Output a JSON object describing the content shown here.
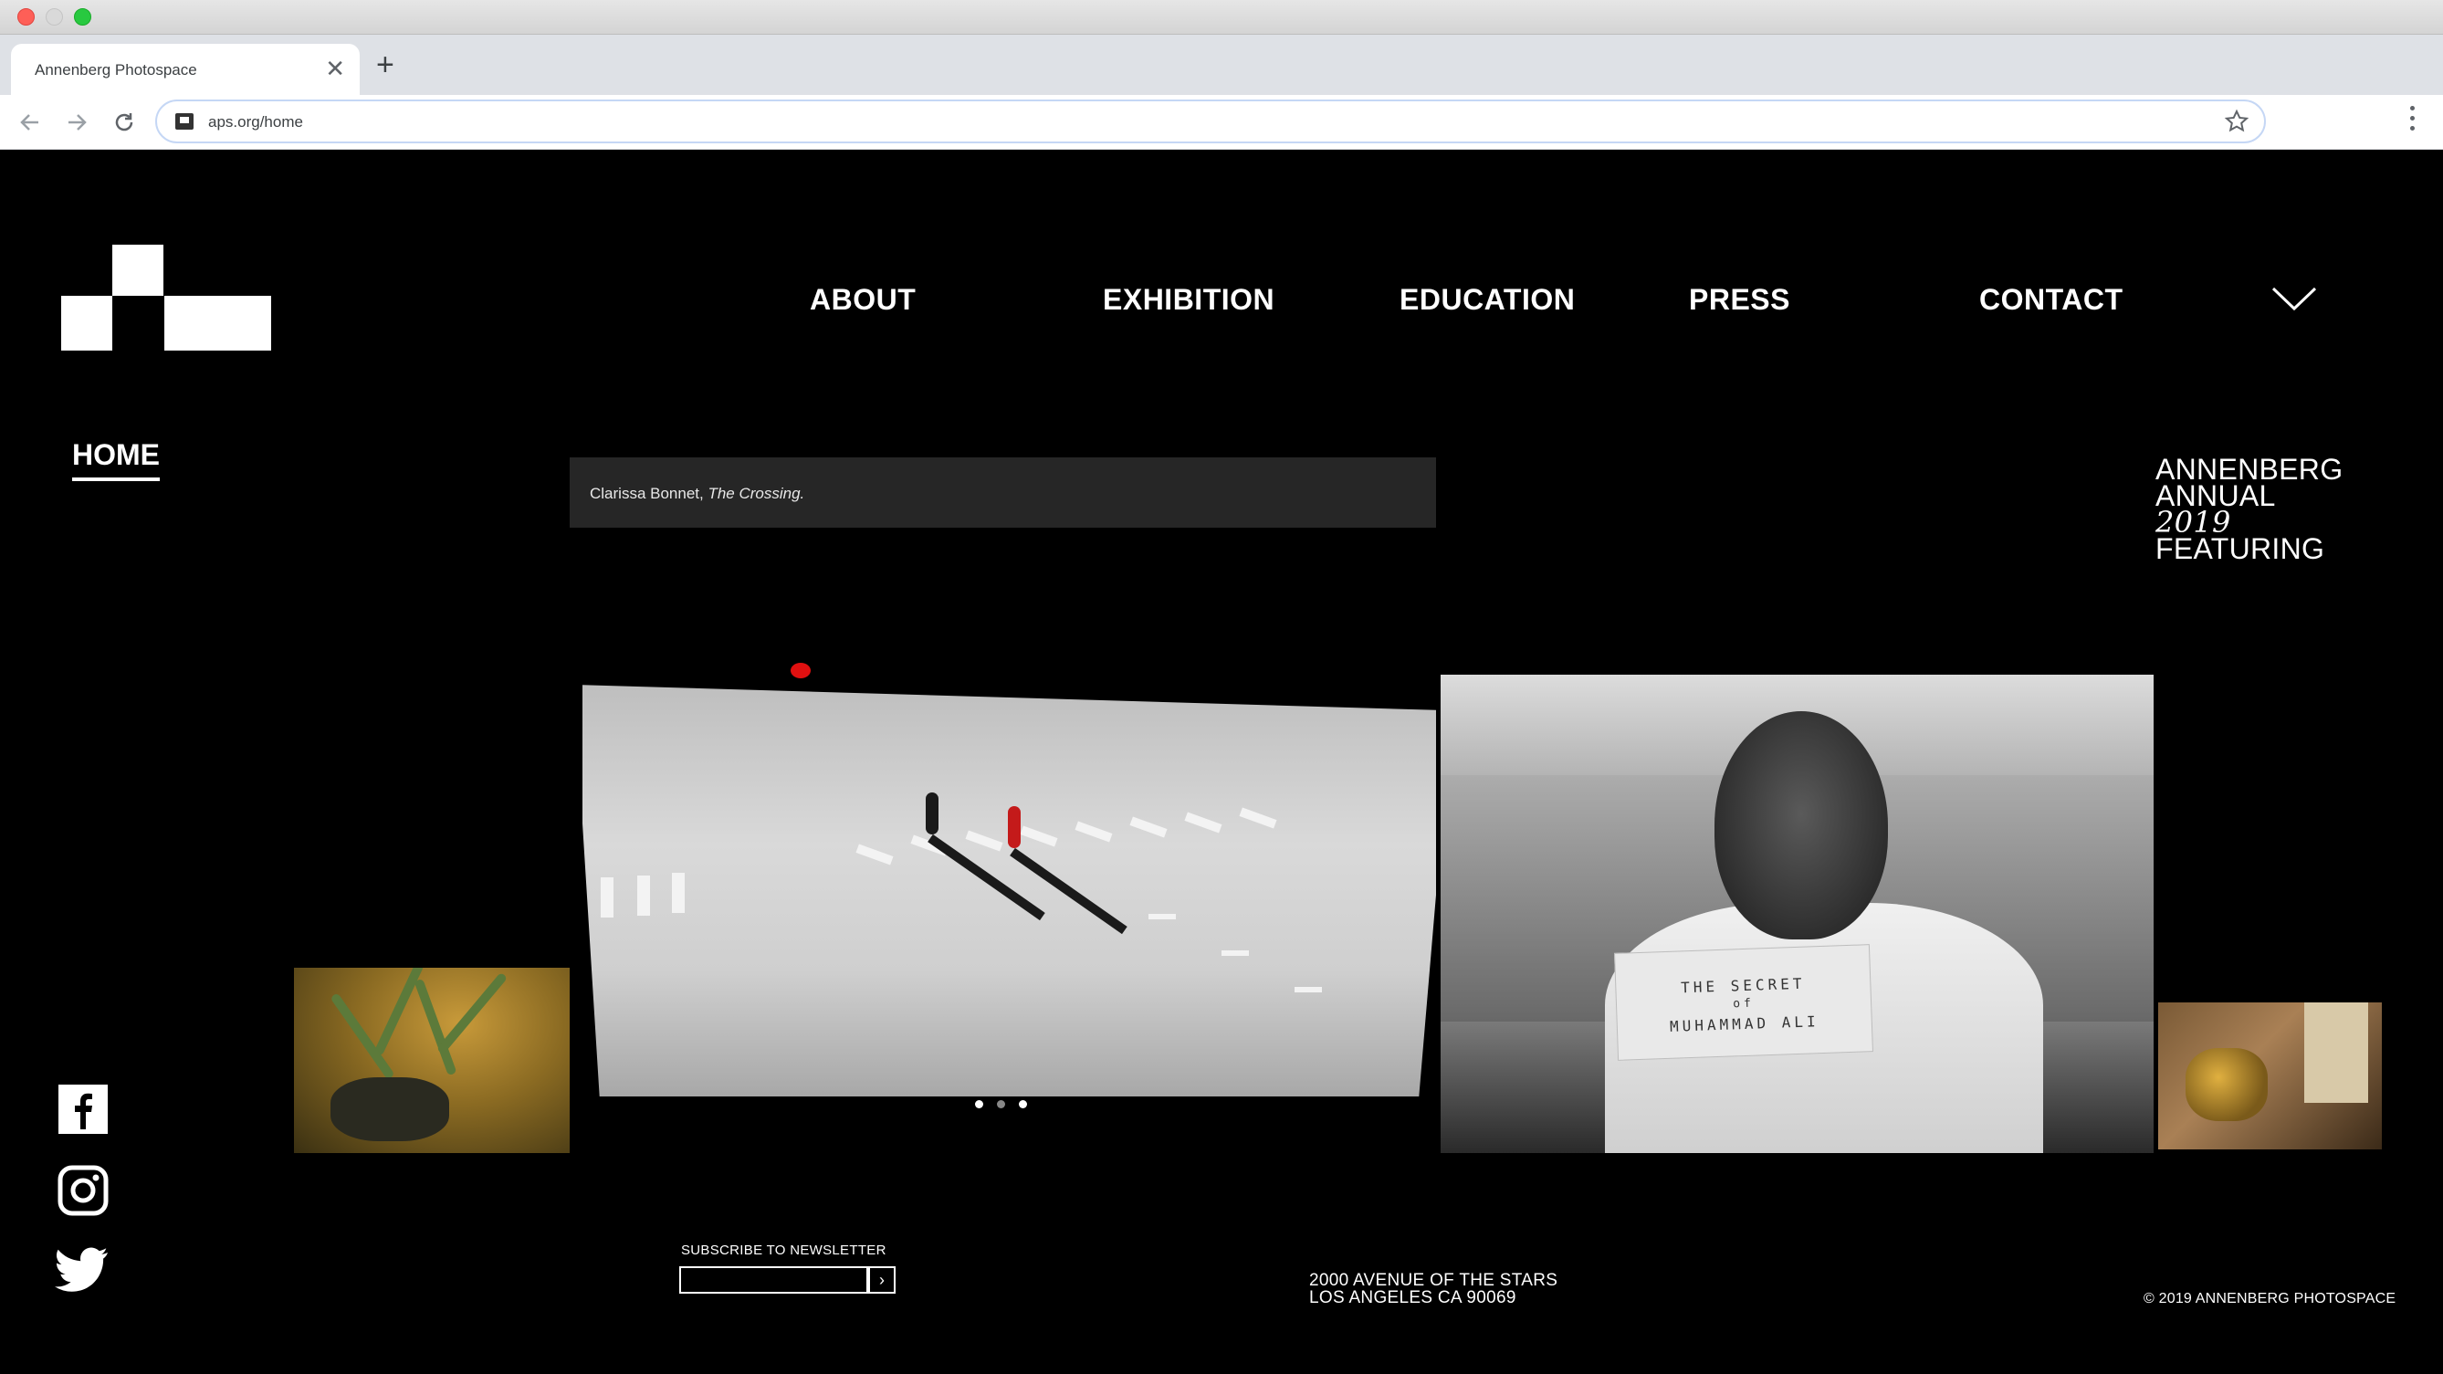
{
  "browser": {
    "tab_title": "Annenberg Photospace",
    "tab_close": "✕",
    "new_tab": "+",
    "url": "aps.org/home",
    "icons": {
      "back": "back-arrow-icon",
      "forward": "forward-arrow-icon",
      "reload": "reload-icon",
      "star": "star-icon",
      "menu": "more-vert-icon"
    }
  },
  "nav": {
    "items": [
      {
        "label": "ABOUT"
      },
      {
        "label": "EXHIBITION"
      },
      {
        "label": "EDUCATION"
      },
      {
        "label": "PRESS"
      },
      {
        "label": "CONTACT"
      }
    ]
  },
  "sidebar": {
    "home": "HOME"
  },
  "hero": {
    "caption_author": "Clarissa Bonnet, ",
    "caption_title": "The Crossing.",
    "ali_card_line1": "THE  SECRET",
    "ali_card_line2": "of",
    "ali_card_line3": "MUHAMMAD  ALI",
    "slides_total": 3,
    "slide_active": 1
  },
  "feature": {
    "line1": "ANNENBERG",
    "line2": "ANNUAL",
    "year": "2019",
    "line4": "FEATURING"
  },
  "social": [
    "facebook-icon",
    "instagram-icon",
    "twitter-icon"
  ],
  "footer": {
    "newsletter_label": "SUBSCRIBE TO NEWSLETTER",
    "newsletter_value": "",
    "newsletter_btn": "›",
    "address_line1": "2000 AVENUE OF THE STARS",
    "address_line2": "LOS ANGELES CA 90069",
    "copyright": "© 2019 ANNENBERG PHOTOSPACE"
  },
  "colors": {
    "page_bg": "#000000",
    "text": "#ffffff",
    "caption_bg": "#262626",
    "signal_red": "#e01010"
  }
}
